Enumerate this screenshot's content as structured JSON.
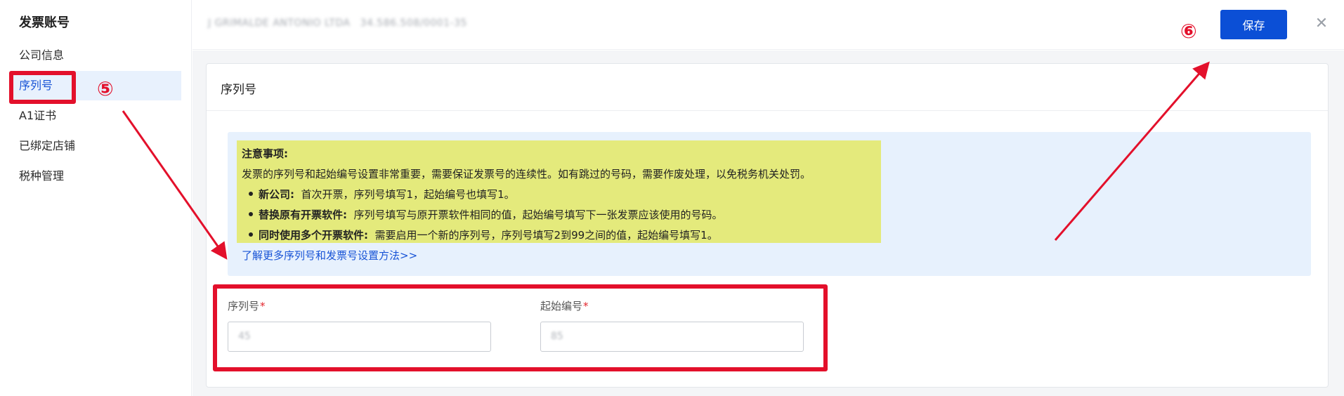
{
  "sidebar": {
    "title": "发票账号",
    "items": [
      {
        "label": "公司信息"
      },
      {
        "label": "序列号",
        "active": true
      },
      {
        "label": "A1证书"
      },
      {
        "label": "已绑定店铺"
      },
      {
        "label": "税种管理"
      }
    ]
  },
  "header": {
    "company_name": "J GRIMALDE ANTONIO LTDA",
    "company_tax_id": "34.586.508/0001-35",
    "save_label": "保存",
    "close_icon": "close-icon"
  },
  "card": {
    "title": "序列号"
  },
  "notice": {
    "title": "注意事项:",
    "description": "发票的序列号和起始编号设置非常重要，需要保证发票号的连续性。如有跳过的号码，需要作废处理，以免税务机关处罚。",
    "items": [
      {
        "label": "新公司:",
        "text": "首次开票，序列号填写1，起始编号也填写1。"
      },
      {
        "label": "替换原有开票软件:",
        "text": "序列号填写与原开票软件相同的值，起始编号填写下一张发票应该使用的号码。"
      },
      {
        "label": "同时使用多个开票软件:",
        "text": "需要启用一个新的序列号，序列号填写2到99之间的值，起始编号填写1。"
      }
    ],
    "link": "了解更多序列号和发票号设置方法>>",
    "highlight_color": "#e4ea7c"
  },
  "form": {
    "serial_label": "序列号",
    "serial_value": "45",
    "start_label": "起始编号",
    "start_value": "85",
    "required_mark": "*"
  },
  "annotations": {
    "badge_5": "⑤",
    "badge_6": "⑥",
    "color": "#e3102b"
  },
  "colors": {
    "accent": "#0b4fd6",
    "active_bg": "#e8f1fd",
    "notice_bg": "#e7f1fd",
    "required": "#e3262d"
  }
}
